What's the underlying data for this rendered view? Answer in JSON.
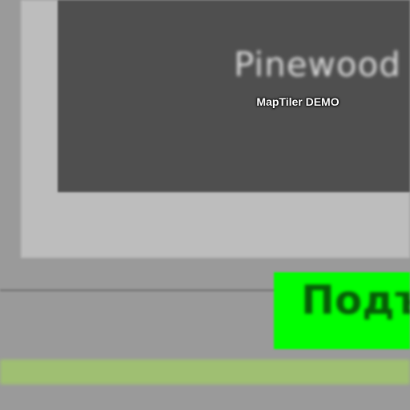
{
  "map": {
    "place_label": "Pinewood",
    "sign_label": "Подъ",
    "watermark": "MapTiler DEMO"
  },
  "colors": {
    "background": "#9a9a9a",
    "frame_light": "#bdbdbd",
    "inner_dark": "#4f4f4f",
    "sign_green": "#00ff00",
    "road_band": "#9fbf72"
  }
}
